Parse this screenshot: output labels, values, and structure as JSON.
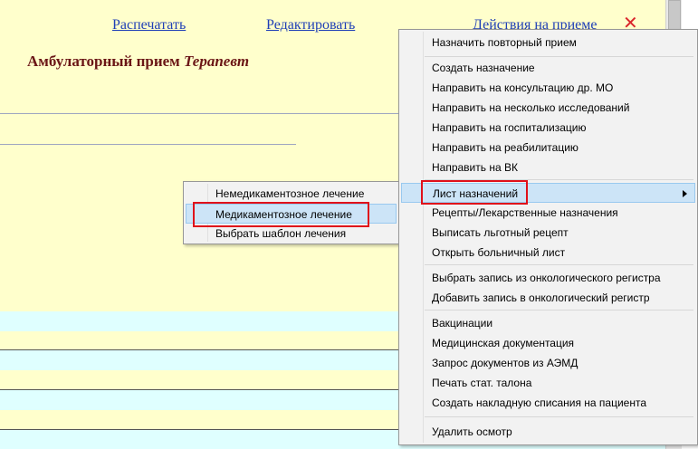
{
  "toolbar": {
    "print_label": "Распечатать",
    "edit_label": "Редактировать",
    "actions_label": "Действия на приеме",
    "close_glyph": "✕"
  },
  "page": {
    "title_main": "Амбулаторный прием",
    "title_role": "Терапевт"
  },
  "actions_menu": {
    "items": [
      "Назначить повторный прием",
      "Создать назначение",
      "Направить на консультацию др. МО",
      "Направить на несколько исследований",
      "Направить на госпитализацию",
      "Направить на реабилитацию",
      "Направить на ВК",
      "Лист назначений",
      "Рецепты/Лекарственные назначения",
      "Выписать льготный рецепт",
      "Открыть больничный лист",
      "Выбрать запись из онкологического регистра",
      "Добавить запись в онкологический регистр",
      "Вакцинации",
      "Медицинская документация",
      "Запрос документов из АЭМД",
      "Печать стат. талона",
      "Создать накладную списания на пациента",
      "Удалить осмотр"
    ],
    "highlighted": "Лист назначений"
  },
  "submenu": {
    "items": [
      "Немедикаментозное лечение",
      "Медикаментозное лечение",
      "Выбрать шаблон лечения"
    ],
    "highlighted": "Медикаментозное лечение"
  },
  "colors": {
    "page_bg": "#ffffcc",
    "row_cyan": "#dfffff",
    "link": "#1f3fb6",
    "heading": "#6b1616",
    "highlight": "#cce4f7",
    "annotation_red": "#e0101a"
  }
}
